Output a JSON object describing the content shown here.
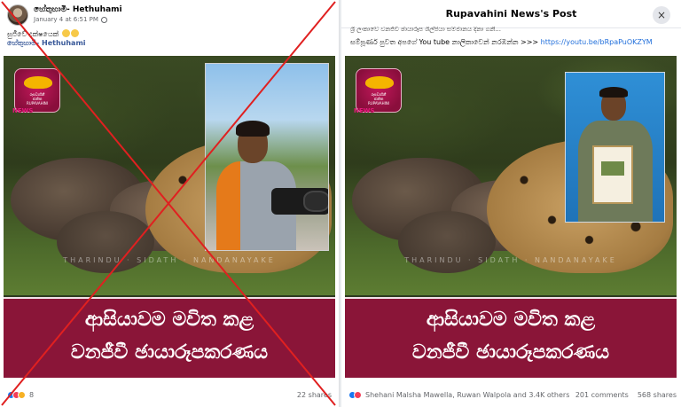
{
  "left_post": {
    "author": "හේතුහාමි- Hethuhami",
    "timestamp": "January 4 at 6:51 PM",
    "caption": "සුජීවේ දක්ෂයෙක් ",
    "tag": "හේතුහාමි- Hethuhami",
    "logo_text": "රූපවාහිනී\nජාතික\nRUPAVAHINI",
    "logo_news": "NEWS",
    "watermark": "THARINDU · SIDATH · NANDANAYAKE",
    "banner_line1": "ආසියාවම මවිත කළ",
    "banner_line2": "වනජීවී ඡායාරූපකරණය",
    "reaction_count": "8",
    "shares": "22 shares"
  },
  "right_post": {
    "title": "Rupavahini News's Post",
    "close_icon": "×",
    "cut_text": "ශ්‍රී ලංකාවේ වනජීවී ඡායාරූප ශිල්පියා සම්මානය දිනා ගනී...",
    "link_prefix": "සම්පූර්ණ පුවත අපගේ You tube නාලිකාවෙන් නරඹන්න >>> ",
    "link_url": "https://youtu.be/bRpaPuOKZYM",
    "logo_text": "රූපවාහිනී\nජාතික\nRUPAVAHINI",
    "logo_news": "NEWS",
    "watermark": "THARINDU · SIDATH · NANDANAYAKE",
    "banner_line1": "ආසියාවම මවිත කළ",
    "banner_line2": "වනජීවී ඡායාරූපකරණය",
    "reaction_names": "Shehani Malsha Mawella, Ruwan Walpola and 3.4K others",
    "comments": "201 comments",
    "shares": "568 shares"
  },
  "colors": {
    "banner": "#8a1538",
    "fake_cross": "#e02020",
    "link": "#216fdb"
  }
}
